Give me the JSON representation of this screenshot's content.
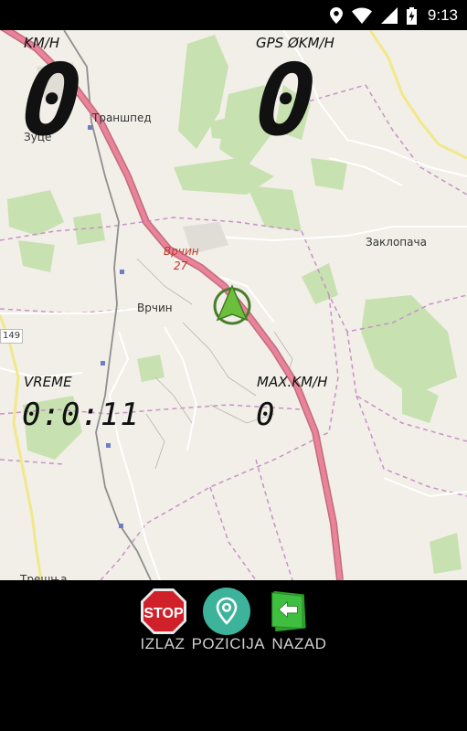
{
  "status_bar": {
    "time": "9:13",
    "icons": [
      "location-icon",
      "wifi-icon",
      "signal-icon",
      "battery-charging-icon"
    ]
  },
  "map": {
    "labels": [
      {
        "id": "transhped",
        "text": "Траншпед"
      },
      {
        "id": "zuce",
        "text": "Зуце"
      },
      {
        "id": "vrcin-town",
        "text": "Врчин"
      },
      {
        "id": "vrcin-exit",
        "text": "Врчин"
      },
      {
        "id": "exit-number",
        "text": "27"
      },
      {
        "id": "zaklopaca",
        "text": "Заклопача"
      },
      {
        "id": "tresnja",
        "text": "Трешња"
      }
    ],
    "road_number": "149",
    "position_marker": "navigation-arrow-icon"
  },
  "hud": {
    "speed": {
      "label": "KM/H",
      "value": "0"
    },
    "gps_speed": {
      "label": "GPS ØKM/H",
      "value": "0"
    },
    "time": {
      "label": "VREME",
      "value": "0:0:11"
    },
    "max_speed": {
      "label": "MAX.KM/H",
      "value": "0"
    }
  },
  "controls": {
    "stop_icon_text": "STOP",
    "buttons": [
      {
        "id": "izlaz",
        "icon": "stop-sign-icon",
        "label": "IZLAZ"
      },
      {
        "id": "pozicija",
        "icon": "location-pin-icon",
        "label": "POZICIJA"
      },
      {
        "id": "nazad",
        "icon": "back-arrow-icon",
        "label": "NAZAD"
      }
    ]
  },
  "colors": {
    "motorway": "#e8839a",
    "forest": "#c8e1b0",
    "boundary": "#c792c7",
    "marker_green": "#6cbf3c",
    "pin_teal": "#3cb39a",
    "back_green": "#3fbf3f",
    "stop_red": "#d0202a"
  }
}
